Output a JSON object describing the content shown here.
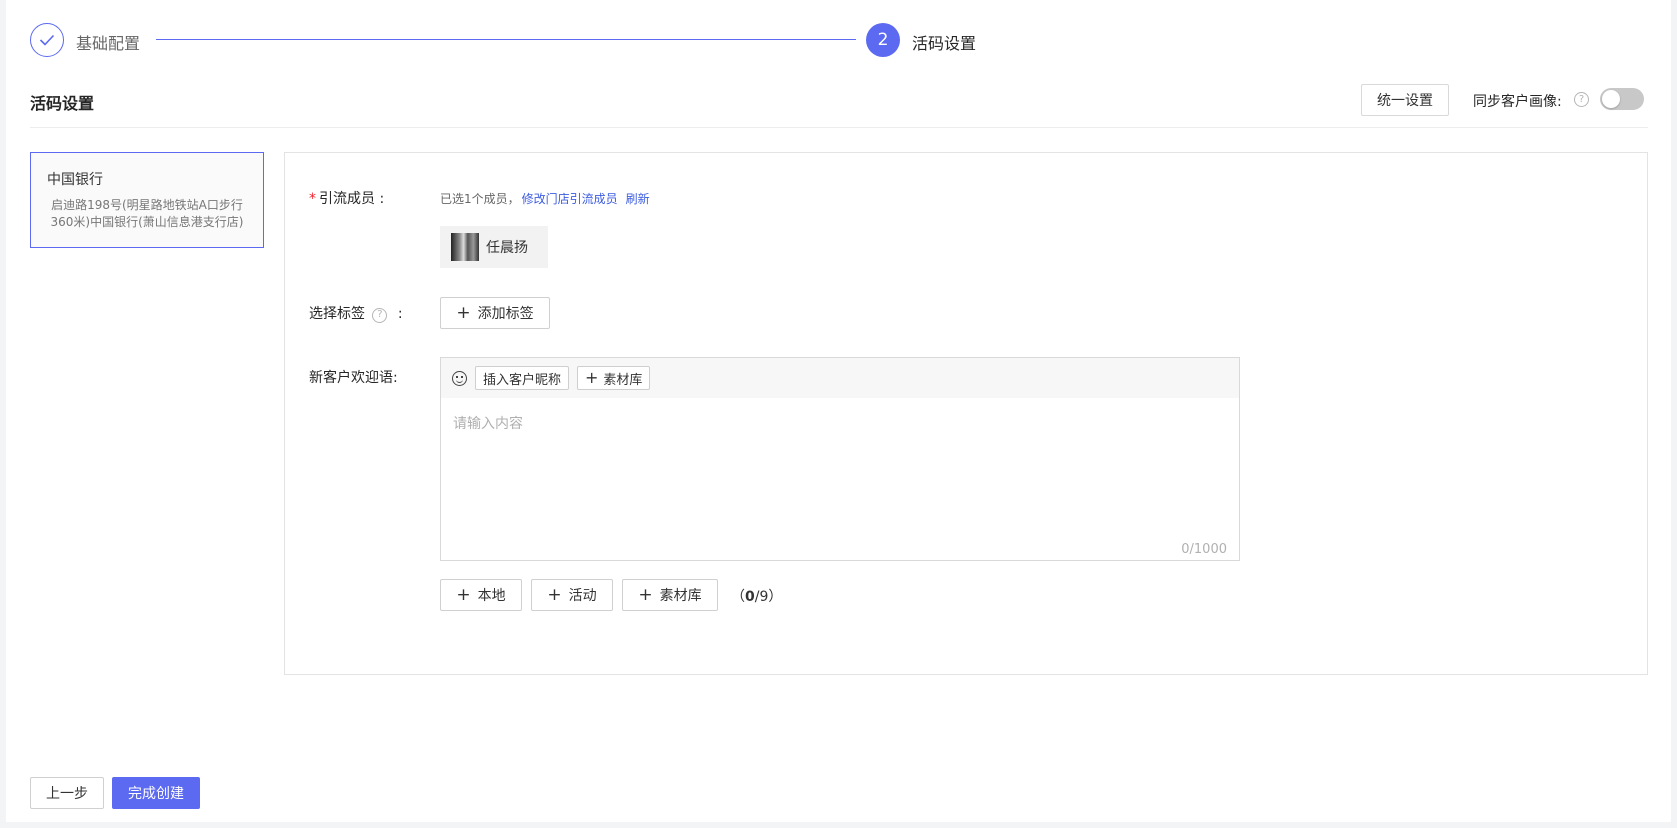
{
  "steps": {
    "step1": {
      "label": "基础配置",
      "status": "done"
    },
    "step2": {
      "number": "2",
      "label": "活码设置",
      "status": "active"
    }
  },
  "section": {
    "title": "活码设置",
    "unify_button": "统一设置",
    "sync_label": "同步客户画像:",
    "sync_help": "?",
    "sync_enabled": false
  },
  "store": {
    "name": "中国银行",
    "address": "启迪路198号(明星路地铁站A口步行360米)中国银行(萧山信息港支行店)"
  },
  "form": {
    "members": {
      "required_mark": "*",
      "label": "引流成员 :",
      "hint": "已选1个成员，",
      "modify_link": "修改门店引流成员",
      "refresh_link": "刷新",
      "selected": [
        {
          "name": "任晨扬"
        }
      ]
    },
    "tags": {
      "label": "选择标签",
      "help": "?",
      "colon": ":",
      "add_button": "添加标签"
    },
    "welcome": {
      "label": "新客户欢迎语:",
      "insert_nickname": "插入客户昵称",
      "material_lib": "素材库",
      "placeholder": "请输入内容",
      "counter": "0/1000"
    },
    "attachments": {
      "local": "本地",
      "activity": "活动",
      "material_lib": "素材库",
      "count_open": "（",
      "count_current": "0",
      "count_rest": "/9）"
    }
  },
  "footer": {
    "prev_button": "上一步",
    "finish_button": "完成创建"
  },
  "colors": {
    "primary": "#5b6af0",
    "link": "#3d5ce0",
    "required": "#f5222d"
  }
}
